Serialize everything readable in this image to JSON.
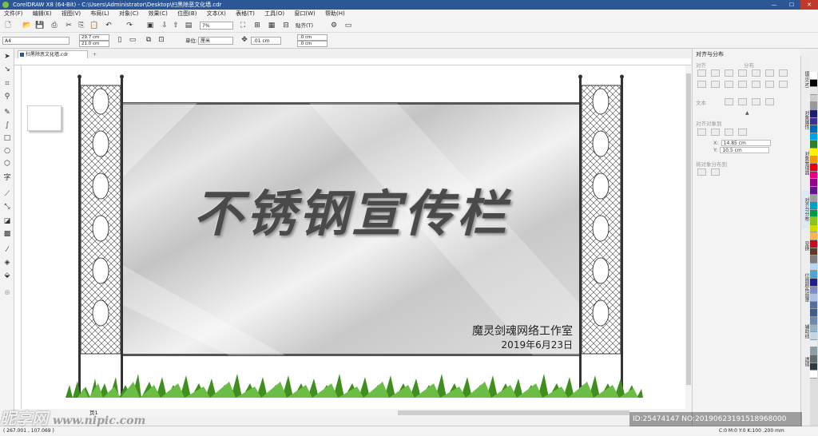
{
  "titlebar": {
    "text": "CorelDRAW X8 (64-Bit) - C:\\Users\\Administrator\\Desktop\\扫黑除恶文化墙.cdr",
    "minimize": "—",
    "maximize": "☐",
    "close": "✕"
  },
  "menu": [
    "文件(F)",
    "编辑(E)",
    "视图(V)",
    "布局(L)",
    "对象(C)",
    "效果(C)",
    "位图(B)",
    "文本(X)",
    "表格(T)",
    "工具(O)",
    "窗口(W)",
    "帮助(H)"
  ],
  "toolbar": {
    "zoom": "7%",
    "snap_label": "贴齐(T)"
  },
  "propbar": {
    "page_size": "A4",
    "width": "29.7 cm",
    "height": "21.0 cm",
    "unit_label": "单位:",
    "unit_value": "厘米",
    "nudge": ".01 cm",
    "dup_x": ".0 cm",
    "dup_y": ".0 cm"
  },
  "document_tab": "扫黑除恶文化墙.cdr",
  "design": {
    "headline": "不锈钢宣传栏",
    "studio": "魔灵剑魂网络工作室",
    "date": "2019年6月23日"
  },
  "dock": {
    "title": "对齐与分布",
    "align_label": "对齐",
    "distribute_label": "分布",
    "text_label": "文本",
    "align_to_label": "对齐对象到",
    "x_label": "X:",
    "x_value": "14.85 cm",
    "y_label": "Y:",
    "y_value": "10.5 cm",
    "distribute_to_label": "将对象分布到"
  },
  "side_tabs": [
    "提示(N)",
    "对象属性",
    "对象管理器",
    "对齐与分布",
    "变换",
    "位图颜色遮罩",
    "辅助线",
    "透镜"
  ],
  "palette_colors": [
    "#ffffff",
    "#000000",
    "#e6e6e6",
    "#cccccc",
    "#999999",
    "#1b1c6b",
    "#3c2f8f",
    "#006ab4",
    "#00a0e9",
    "#2e7d32",
    "#fff100",
    "#f39800",
    "#e60012",
    "#e4007f",
    "#920783",
    "#601986",
    "#a0a0a0",
    "#00a0c6",
    "#009944",
    "#8fc31f",
    "#cfdb00",
    "#f8b551",
    "#c30d23",
    "#5d3b2a",
    "#7d7d7d",
    "#bcd8ef",
    "#4ea3d8",
    "#1d2088",
    "#7e8ec2",
    "#aebfdf",
    "#5a6e9c",
    "#3d5f8a",
    "#6b8cae",
    "#96b5c9",
    "#c5d6e0",
    "#e8eef2",
    "#8e9fa8",
    "#5e6d74",
    "#2f3a3f",
    "#ffffff"
  ],
  "pagenav": {
    "page_label": "页1"
  },
  "statusbar": {
    "coords": "( 267.001 , 107.069 )",
    "right_info": "C:0 M:0 Y:0 K:100  .200 mm"
  },
  "watermark": {
    "logo": "昵享网",
    "url": "www.nipic.com",
    "info": "ID:25474147 NO:20190623191518968000"
  }
}
